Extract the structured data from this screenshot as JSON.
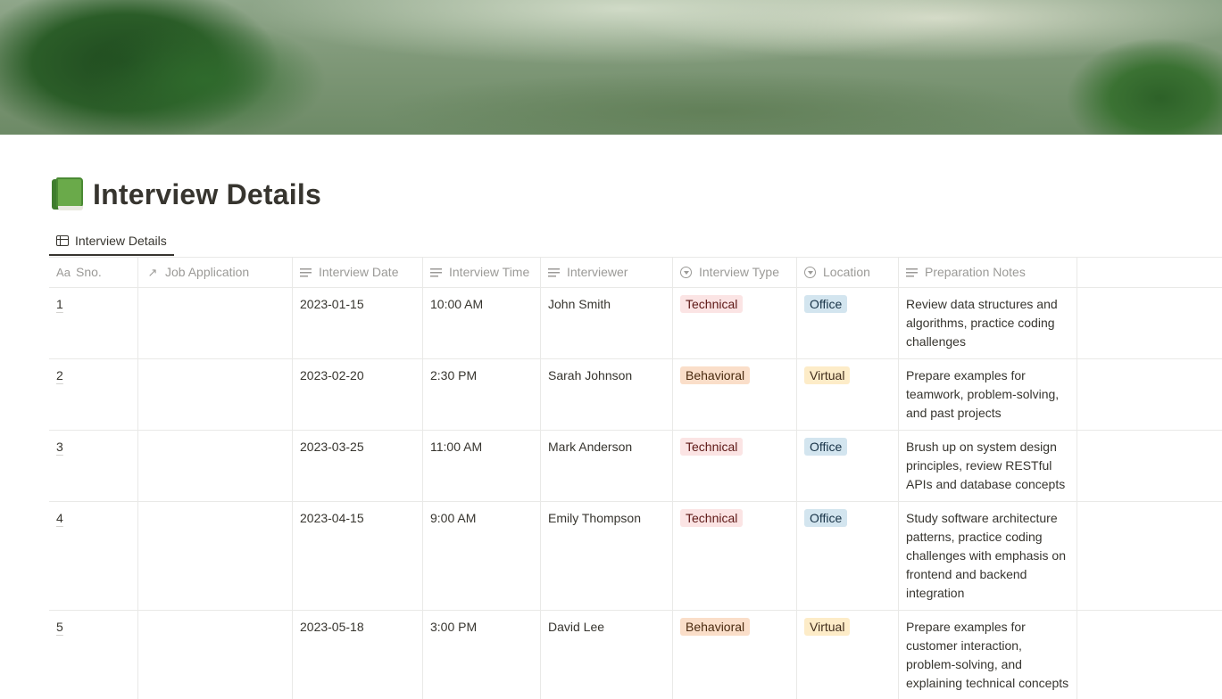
{
  "page": {
    "title": "Interview Details",
    "icon": "green-book-icon"
  },
  "view_tab": {
    "label": "Interview Details",
    "icon": "table-icon"
  },
  "columns": [
    {
      "label": "Sno.",
      "icon": "title-aa-icon"
    },
    {
      "label": "Job Application",
      "icon": "relation-arrow-icon"
    },
    {
      "label": "Interview Date",
      "icon": "text-lines-icon"
    },
    {
      "label": "Interview Time",
      "icon": "text-lines-icon"
    },
    {
      "label": "Interviewer",
      "icon": "text-lines-icon"
    },
    {
      "label": "Interview Type",
      "icon": "select-icon"
    },
    {
      "label": "Location",
      "icon": "select-icon"
    },
    {
      "label": "Preparation Notes",
      "icon": "text-lines-icon"
    }
  ],
  "rows": [
    {
      "sno": "1",
      "job_application": "",
      "date": "2023-01-15",
      "time": "10:00 AM",
      "interviewer": "John Smith",
      "type": "Technical",
      "location": "Office",
      "notes": "Review data structures and algorithms, practice coding challenges"
    },
    {
      "sno": "2",
      "job_application": "",
      "date": "2023-02-20",
      "time": "2:30 PM",
      "interviewer": "Sarah Johnson",
      "type": "Behavioral",
      "location": "Virtual",
      "notes": "Prepare examples for teamwork, problem-solving, and past projects"
    },
    {
      "sno": "3",
      "job_application": "",
      "date": "2023-03-25",
      "time": "11:00 AM",
      "interviewer": "Mark Anderson",
      "type": "Technical",
      "location": "Office",
      "notes": "Brush up on system design principles, review RESTful APIs and database concepts"
    },
    {
      "sno": "4",
      "job_application": "",
      "date": "2023-04-15",
      "time": "9:00 AM",
      "interviewer": "Emily Thompson",
      "type": "Technical",
      "location": "Office",
      "notes": "Study software architecture patterns, practice coding challenges with emphasis on frontend and backend integration"
    },
    {
      "sno": "5",
      "job_application": "",
      "date": "2023-05-18",
      "time": "3:00 PM",
      "interviewer": "David Lee",
      "type": "Behavioral",
      "location": "Virtual",
      "notes": "Prepare examples for customer interaction, problem-solving, and explaining technical concepts"
    }
  ],
  "tag_colors": {
    "Technical": "#fbe4e4",
    "Behavioral": "#fadec9",
    "Office": "#d3e5ef",
    "Virtual": "#fdecc8"
  }
}
